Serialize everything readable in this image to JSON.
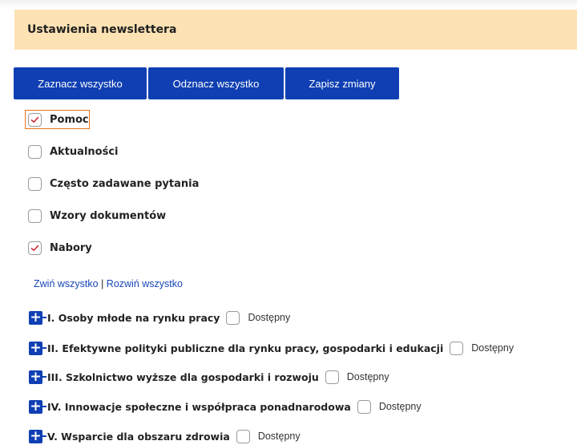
{
  "header": {
    "title": "Ustawienia newslettera"
  },
  "toolbar": {
    "select_all_label": "Zaznacz wszystko",
    "deselect_all_label": "Odznacz wszystko",
    "save_label": "Zapisz zmiany"
  },
  "categories": [
    {
      "label": "Pomoc",
      "checked": true,
      "focused": true
    },
    {
      "label": "Aktualności",
      "checked": false
    },
    {
      "label": "Często zadawane pytania",
      "checked": false
    },
    {
      "label": "Wzory dokumentów",
      "checked": false
    },
    {
      "label": "Nabory",
      "checked": true
    }
  ],
  "tree_links": {
    "collapse_all": "Zwiń wszystko",
    "separator": "|",
    "expand_all": "Rozwiń wszystko"
  },
  "tree": [
    {
      "label": "I. Osoby młode na rynku pracy",
      "available_label": "Dostępny",
      "checked": false
    },
    {
      "label": "II. Efektywne polityki publiczne dla rynku pracy, gospodarki i edukacji",
      "available_label": "Dostępny",
      "checked": false
    },
    {
      "label": "III. Szkolnictwo wyższe dla gospodarki i rozwoju",
      "available_label": "Dostępny",
      "checked": false
    },
    {
      "label": "IV. Innowacje społeczne i współpraca ponadnarodowa",
      "available_label": "Dostępny",
      "checked": false
    },
    {
      "label": "V. Wsparcie dla obszaru zdrowia",
      "available_label": "Dostępny",
      "checked": false
    }
  ],
  "colors": {
    "accent": "#0f3fb3",
    "header_bg": "#fde2b4",
    "check": "#d0202a",
    "focus": "#e8731a"
  }
}
